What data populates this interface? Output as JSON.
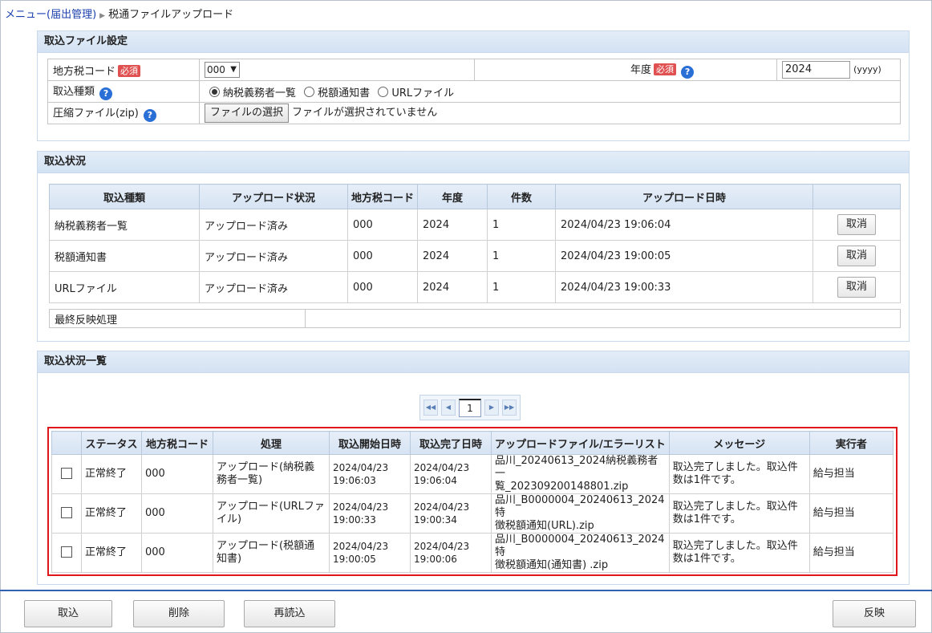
{
  "breadcrumb": {
    "parent": "メニュー(届出管理)",
    "current": "税通ファイルアップロード"
  },
  "settings": {
    "title": "取込ファイル設定",
    "local_tax_code_label": "地方税コード",
    "required": "必須",
    "local_tax_code_value": "000",
    "year_label": "年度",
    "year_value": "2024",
    "year_format": "(yyyy)",
    "import_type_label": "取込種類",
    "import_type_options": [
      "納税義務者一覧",
      "税額通知書",
      "URLファイル"
    ],
    "zip_label": "圧縮ファイル(zip)",
    "file_button": "ファイルの選択",
    "no_file": "ファイルが選択されていません"
  },
  "status": {
    "title": "取込状況",
    "headers": [
      "取込種類",
      "アップロード状況",
      "地方税コード",
      "年度",
      "件数",
      "アップロード日時",
      ""
    ],
    "rows": [
      {
        "type": "納税義務者一覧",
        "state": "アップロード済み",
        "code": "000",
        "year": "2024",
        "count": "1",
        "datetime": "2024/04/23 19:06:04",
        "cancel": "取消"
      },
      {
        "type": "税額通知書",
        "state": "アップロード済み",
        "code": "000",
        "year": "2024",
        "count": "1",
        "datetime": "2024/04/23 19:00:05",
        "cancel": "取消"
      },
      {
        "type": "URLファイル",
        "state": "アップロード済み",
        "code": "000",
        "year": "2024",
        "count": "1",
        "datetime": "2024/04/23 19:00:33",
        "cancel": "取消"
      }
    ],
    "final_label": "最終反映処理",
    "final_value": ""
  },
  "list": {
    "title": "取込状況一覧",
    "page": "1",
    "headers": [
      "",
      "ステータス",
      "地方税コード",
      "処理",
      "取込開始日時",
      "取込完了日時",
      "アップロードファイル/エラーリスト",
      "メッセージ",
      "実行者"
    ],
    "rows": [
      {
        "status": "正常終了",
        "code": "000",
        "proc1": "アップロード(納税義",
        "proc2": "務者一覧)",
        "s1": "2024/04/23",
        "s2": "19:06:03",
        "e1": "2024/04/23",
        "e2": "19:06:04",
        "f1": "品川_20240613_2024納税義務者一",
        "f2": "覧_202309200148801.zip",
        "m1": "取込完了しました。取込件",
        "m2": "数は1件です。",
        "user": "給与担当"
      },
      {
        "status": "正常終了",
        "code": "000",
        "proc1": "アップロード(URLファ",
        "proc2": "イル)",
        "s1": "2024/04/23",
        "s2": "19:00:33",
        "e1": "2024/04/23",
        "e2": "19:00:34",
        "f1": "品川_B0000004_20240613_2024特",
        "f2": "徴税額通知(URL).zip",
        "m1": "取込完了しました。取込件",
        "m2": "数は1件です。",
        "user": "給与担当"
      },
      {
        "status": "正常終了",
        "code": "000",
        "proc1": "アップロード(税額通",
        "proc2": "知書)",
        "s1": "2024/04/23",
        "s2": "19:00:05",
        "e1": "2024/04/23",
        "e2": "19:00:06",
        "f1": "品川_B0000004_20240613_2024特",
        "f2": "徴税額通知(通知書) .zip",
        "m1": "取込完了しました。取込件",
        "m2": "数は1件です。",
        "user": "給与担当"
      }
    ]
  },
  "footer": {
    "import": "取込",
    "delete": "削除",
    "reload": "再読込",
    "apply": "反映"
  },
  "colors": {
    "accent": "#2f63b0",
    "highlight_border": "#e0161b",
    "required_badge": "#e05050",
    "help_icon": "#2a6fd6"
  }
}
